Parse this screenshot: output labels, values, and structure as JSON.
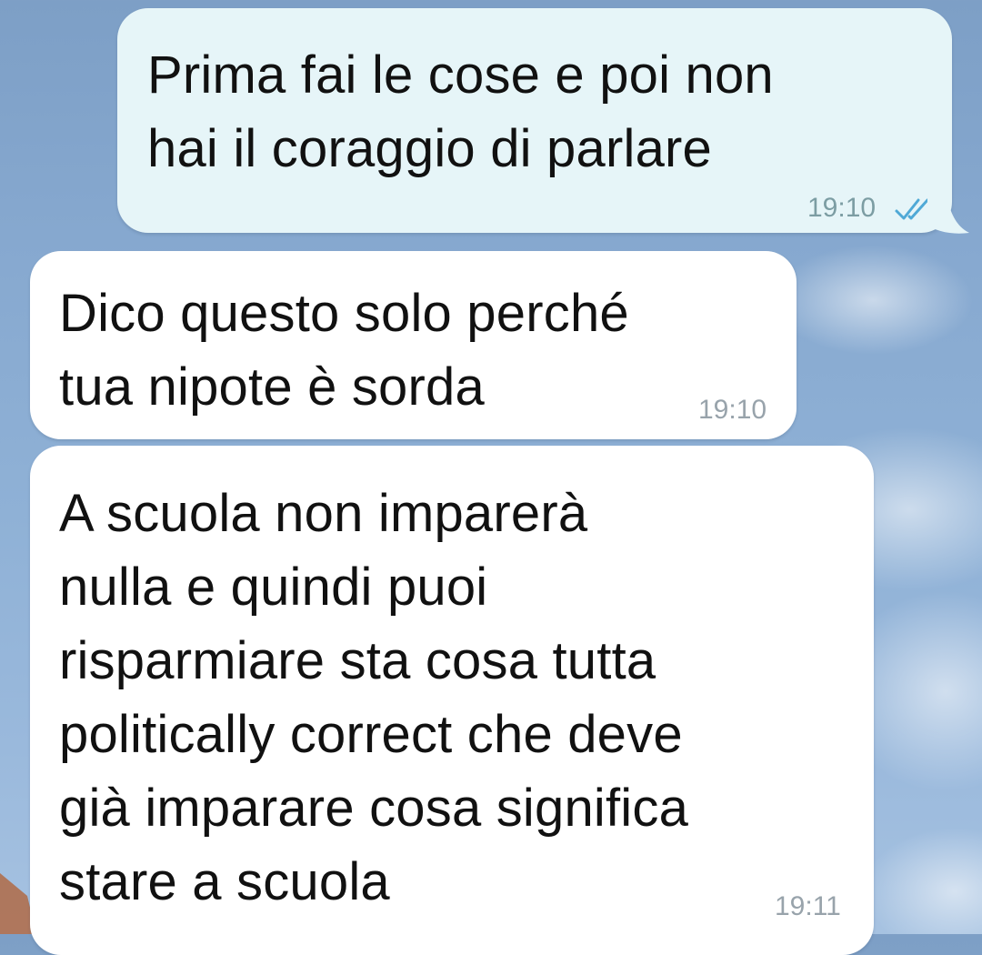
{
  "chat": {
    "messages": [
      {
        "direction": "outgoing",
        "text": "Prima fai le cose e poi non\nhai il coraggio di parlare",
        "time": "19:10",
        "status_icon": "double-check-read-icon"
      },
      {
        "direction": "incoming",
        "text": "Dico questo solo perché\ntua nipote è sorda",
        "time": "19:10"
      },
      {
        "direction": "incoming",
        "text": "A scuola non imparerà\nnulla e quindi puoi\nrisparmiare sta cosa tutta\npolitically correct che deve\ngià imparare cosa significa\nstare a scuola",
        "time": "19:11"
      }
    ]
  },
  "theme": {
    "outgoing_bubble": "#e6f5f8",
    "incoming_bubble": "#ffffff",
    "read_tick_color": "#4fa9d6",
    "wallpaper_sky": "#86a8cf"
  }
}
